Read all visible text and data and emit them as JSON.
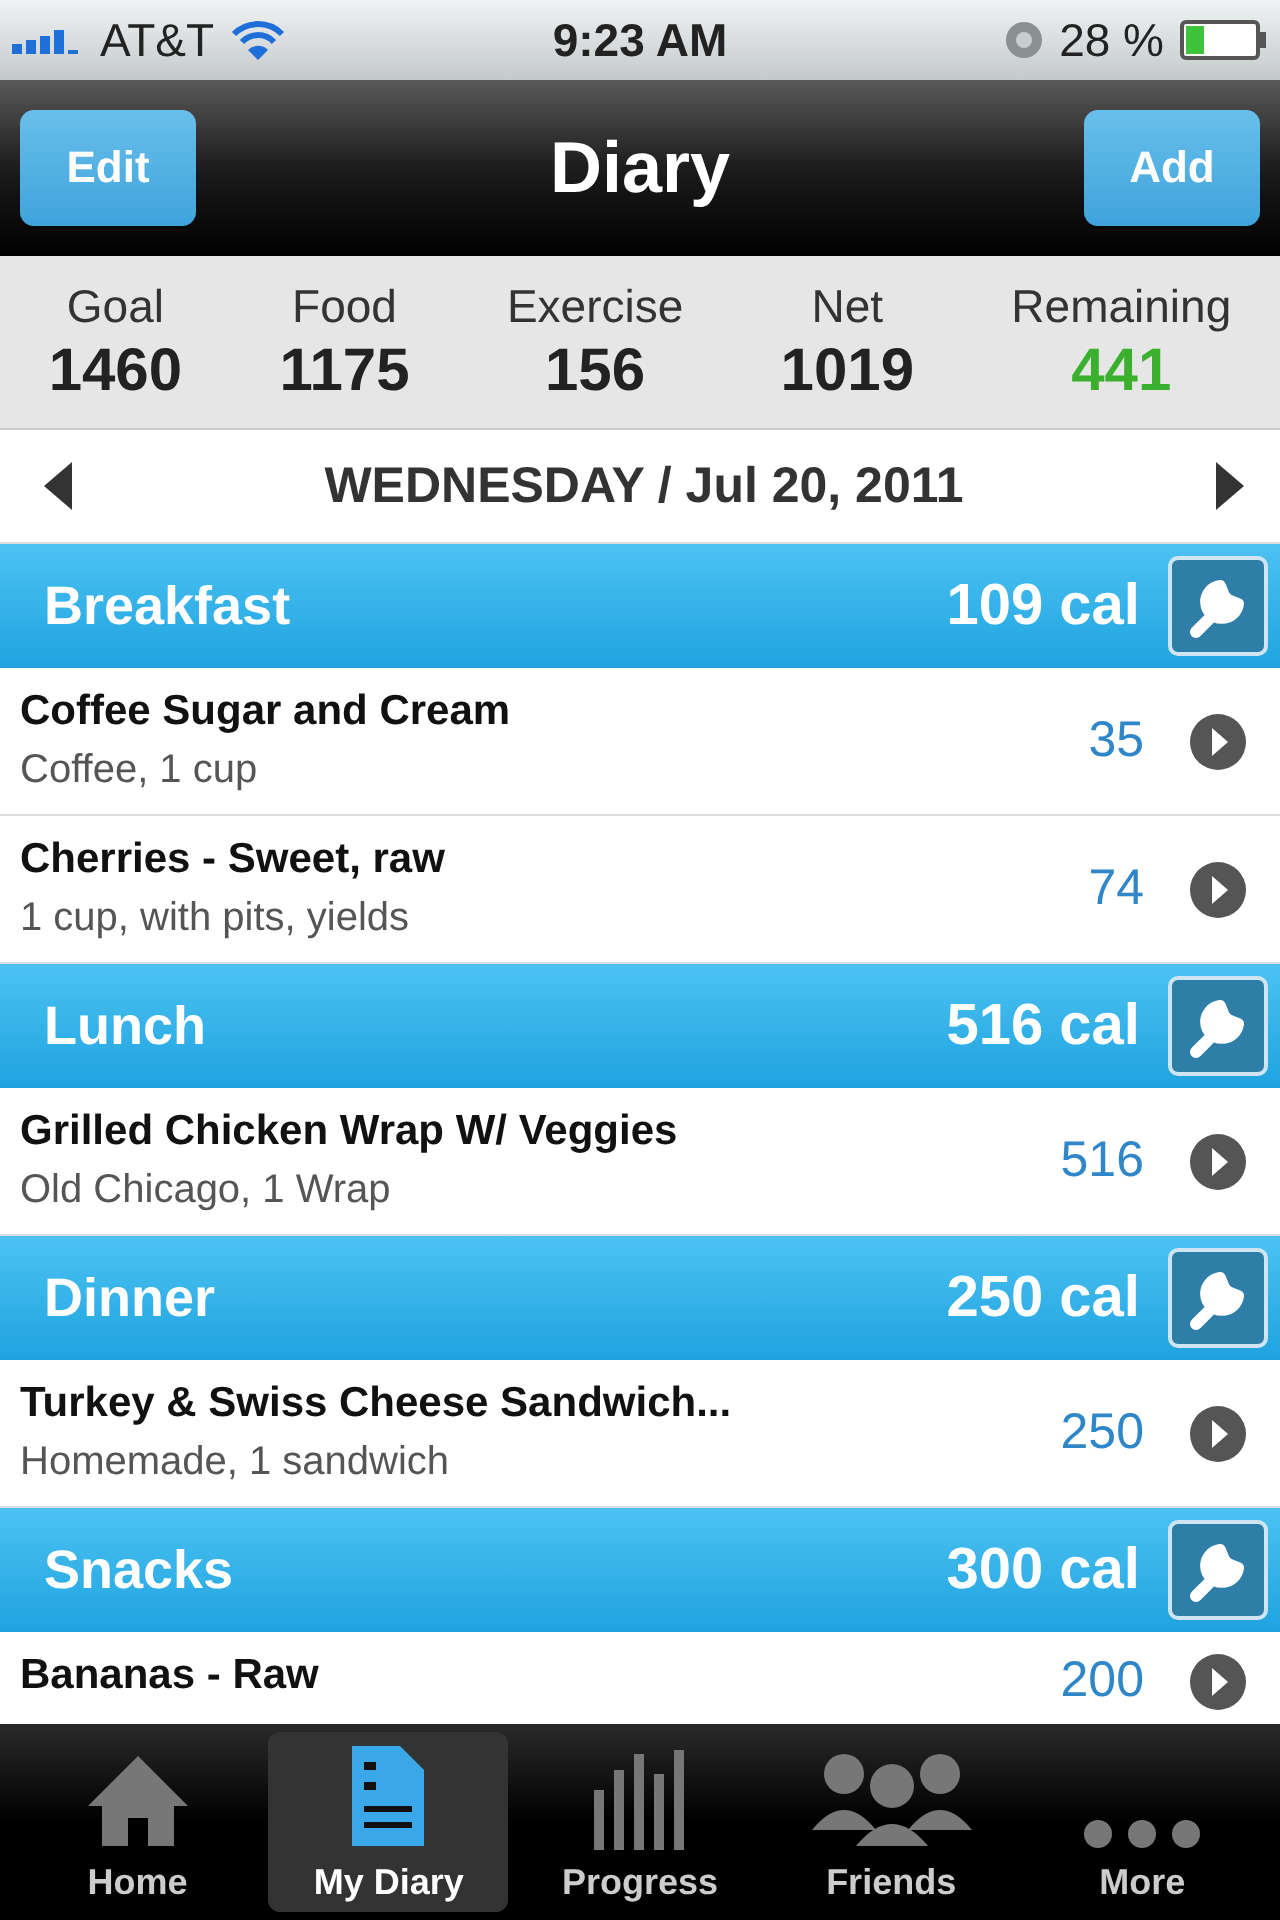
{
  "status_bar": {
    "carrier": "AT&T",
    "time": "9:23 AM",
    "battery": "28 %"
  },
  "nav": {
    "left_button": "Edit",
    "title": "Diary",
    "right_button": "Add"
  },
  "summary": [
    {
      "label": "Goal",
      "value": "1460",
      "kind": "plain"
    },
    {
      "label": "Food",
      "value": "1175",
      "kind": "plain"
    },
    {
      "label": "Exercise",
      "value": "156",
      "kind": "plain"
    },
    {
      "label": "Net",
      "value": "1019",
      "kind": "plain"
    },
    {
      "label": "Remaining",
      "value": "441",
      "kind": "positive"
    }
  ],
  "date": "WEDNESDAY / Jul 20, 2011",
  "meals": [
    {
      "name": "Breakfast",
      "total": "109 cal",
      "items": [
        {
          "name": "Coffee Sugar and Cream",
          "detail": "Coffee, 1 cup",
          "calories": "35"
        },
        {
          "name": "Cherries - Sweet, raw",
          "detail": "1 cup, with pits, yields",
          "calories": "74"
        }
      ]
    },
    {
      "name": "Lunch",
      "total": "516 cal",
      "items": [
        {
          "name": "Grilled Chicken Wrap W/ Veggies",
          "detail": "Old Chicago, 1 Wrap",
          "calories": "516"
        }
      ]
    },
    {
      "name": "Dinner",
      "total": "250 cal",
      "items": [
        {
          "name": "Turkey & Swiss Cheese Sandwich...",
          "detail": "Homemade, 1 sandwich",
          "calories": "250"
        }
      ]
    },
    {
      "name": "Snacks",
      "total": "300 cal",
      "items": [
        {
          "name": "Bananas - Raw",
          "calories": "200"
        }
      ]
    }
  ],
  "tab_bar": [
    {
      "label": "Home",
      "kind": "home",
      "selected": false
    },
    {
      "label": "My Diary",
      "kind": "diary",
      "selected": true
    },
    {
      "label": "Progress",
      "kind": "progress",
      "selected": false
    },
    {
      "label": "Friends",
      "kind": "friends",
      "selected": false
    },
    {
      "label": "More",
      "kind": "more",
      "selected": false
    }
  ]
}
